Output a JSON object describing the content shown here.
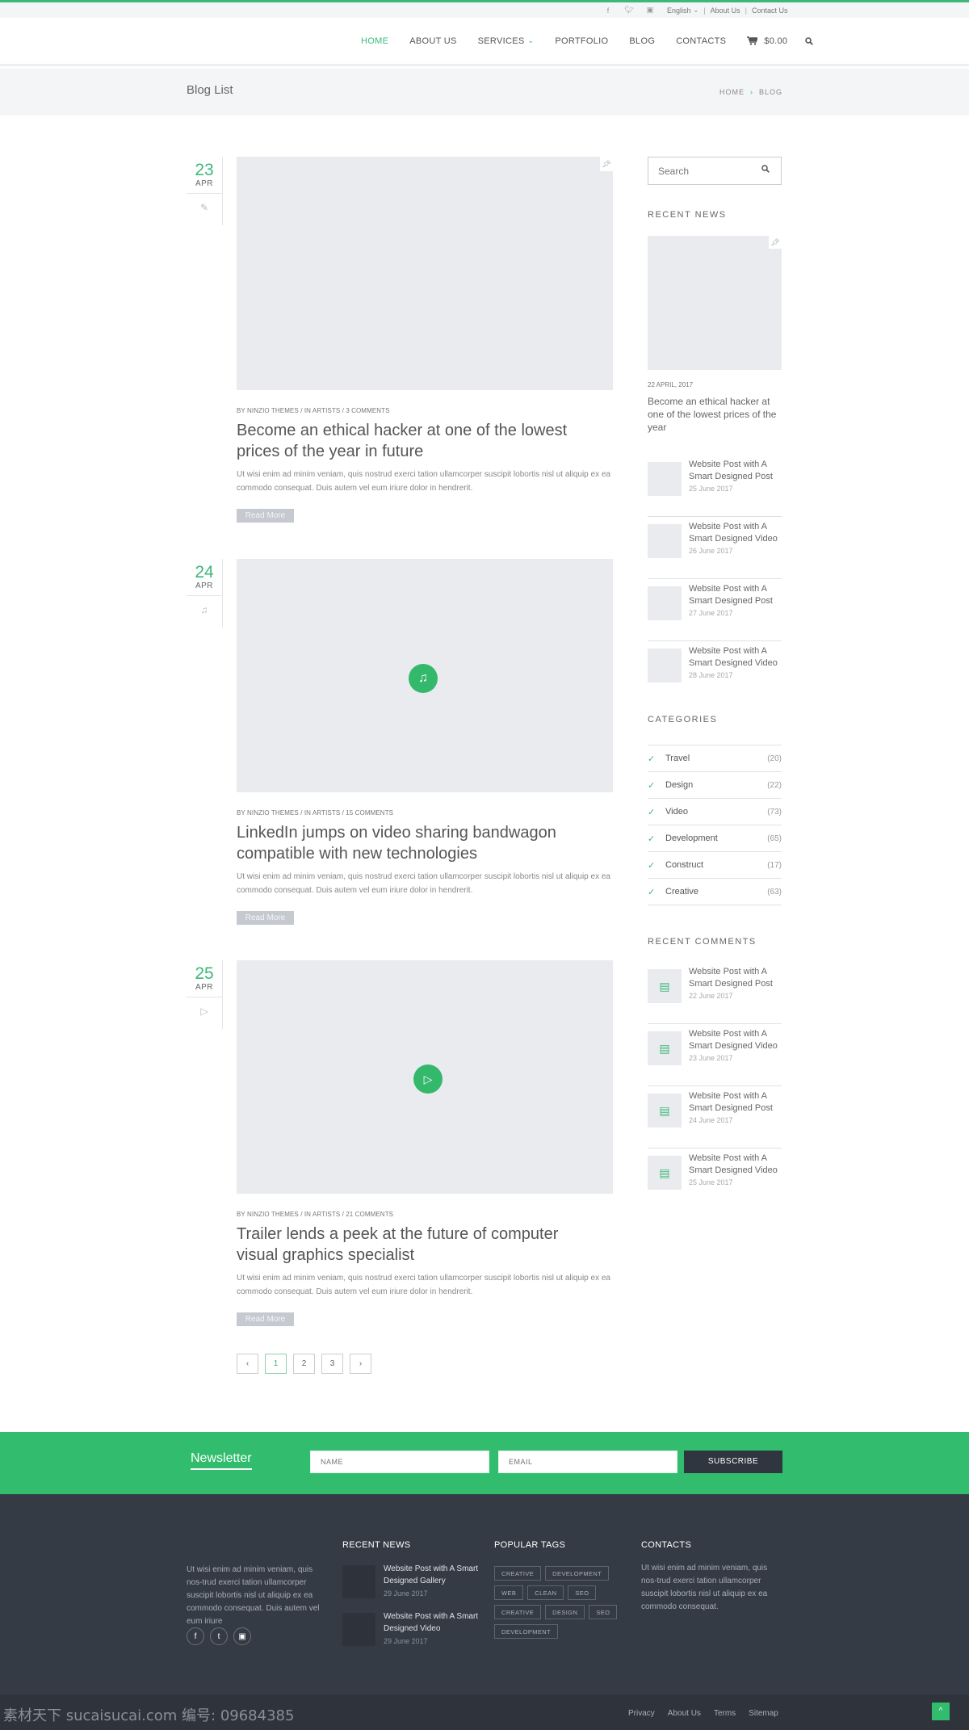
{
  "topbar": {
    "social": [
      "facebook-icon",
      "twitter-icon",
      "instagram-icon"
    ],
    "language": "English",
    "links": [
      "About Us",
      "Contact Us"
    ]
  },
  "nav": {
    "items": [
      {
        "label": "HOME",
        "active": true
      },
      {
        "label": "ABOUT US"
      },
      {
        "label": "SERVICES",
        "dropdown": true
      },
      {
        "label": "PORTFOLIO"
      },
      {
        "label": "BLOG"
      },
      {
        "label": "CONTACTS"
      }
    ],
    "cart_total": "$0.00",
    "icons": {
      "cart": "cart-icon",
      "search": "search-icon"
    }
  },
  "hero": {
    "title": "Blog List",
    "breadcrumb": [
      "HOME",
      "BLOG"
    ]
  },
  "posts": [
    {
      "day": "23",
      "month": "APR",
      "format_icon": "pencil-icon",
      "media_icon": "pin-icon",
      "meta": "BY NINZIO THEMES / IN ARTISTS / 3 COMMENTS",
      "title": "Become an ethical hacker at one of the lowest prices of the year in future",
      "excerpt": "Ut wisi enim ad minim veniam, quis nostrud exerci tation ullamcorper suscipit lobortis nisl ut aliquip ex ea commodo consequat. Duis autem vel eum iriure dolor in hendrerit.",
      "read_more": "Read More"
    },
    {
      "day": "24",
      "month": "APR",
      "format_icon": "music-note-icon",
      "media_icon": "music-note-icon",
      "meta": "BY NINZIO THEMES / IN ARTISTS / 15 COMMENTS",
      "title": "LinkedIn jumps on video sharing bandwagon compatible with new technologies",
      "excerpt": "Ut wisi enim ad minim veniam, quis nostrud exerci tation ullamcorper suscipit lobortis nisl ut aliquip ex ea commodo consequat. Duis autem vel eum iriure dolor in hendrerit.",
      "read_more": "Read More"
    },
    {
      "day": "25",
      "month": "APR",
      "format_icon": "play-icon",
      "media_icon": "play-icon",
      "meta": "BY NINZIO THEMES / IN ARTISTS / 21 COMMENTS",
      "title": "Trailer lends a peek at the future of computer visual graphics specialist",
      "excerpt": "Ut wisi enim ad minim veniam, quis nostrud exerci tation ullamcorper suscipit lobortis nisl ut aliquip ex ea commodo consequat. Duis autem vel eum iriure dolor in hendrerit.",
      "read_more": "Read More"
    }
  ],
  "pagination": {
    "prev": "‹",
    "pages": [
      "1",
      "2",
      "3"
    ],
    "current": "1",
    "next": "›"
  },
  "sidebar": {
    "search_placeholder": "Search",
    "recent_news_title": "RECENT NEWS",
    "featured": {
      "date": "22 APRIL, 2017",
      "title": "Become an ethical hacker at one of the lowest prices of the year"
    },
    "recent_news": [
      {
        "title": "Website Post with A Smart Designed Post",
        "date": "25 June 2017"
      },
      {
        "title": "Website Post with A Smart Designed Video",
        "date": "26 June 2017"
      },
      {
        "title": "Website Post with A Smart Designed Post",
        "date": "27 June 2017"
      },
      {
        "title": "Website Post with A Smart Designed Video",
        "date": "28 June 2017"
      }
    ],
    "categories_title": "CATEGORIES",
    "categories": [
      {
        "name": "Travel",
        "count": "(20)"
      },
      {
        "name": "Design",
        "count": "(22)"
      },
      {
        "name": "Video",
        "count": "(73)"
      },
      {
        "name": "Development",
        "count": "(65)"
      },
      {
        "name": "Construct",
        "count": "(17)"
      },
      {
        "name": "Creative",
        "count": "(63)"
      }
    ],
    "recent_comments_title": "RECENT COMMENTS",
    "recent_comments": [
      {
        "title": "Website Post with A Smart Designed Post",
        "date": "22 June 2017"
      },
      {
        "title": "Website Post with A Smart Designed Video",
        "date": "23 June 2017"
      },
      {
        "title": "Website Post with A Smart Designed Post",
        "date": "24 June 2017"
      },
      {
        "title": "Website Post with A Smart Designed Video",
        "date": "25 June 2017"
      }
    ]
  },
  "newsletter": {
    "title": "Newsletter",
    "name_placeholder": "NAME",
    "email_placeholder": "EMAIL",
    "button": "SUBSCRIBE"
  },
  "footer": {
    "about_text": "Ut wisi enim ad minim veniam, quis nos-trud exerci tation ullamcorper suscipit lobortis nisl ut aliquip ex ea commodo consequat. Duis autem vel eum iriure",
    "recent_news_title": "RECENT NEWS",
    "recent_news": [
      {
        "title": "Website Post with A Smart Designed Gallery",
        "date": "29 June 2017"
      },
      {
        "title": "Website Post with A Smart Designed Video",
        "date": "29 June 2017"
      }
    ],
    "tags_title": "POPULAR TAGS",
    "tags": [
      "CREATIVE",
      "DEVELOPMENT",
      "WEB",
      "CLEAN",
      "SEO",
      "CREATIVE",
      "DESIGN",
      "SEO",
      "DEVELOPMENT"
    ],
    "contacts_title": "CONTACTS",
    "contacts_text": "Ut wisi enim ad minim veniam, quis nos-trud exerci tation ullamcorper suscipit lobortis nisl ut aliquip ex ea commodo consequat."
  },
  "bottom": {
    "watermark": "素材天下 sucaisucai.com  编号: 09684385",
    "links": [
      "Privacy",
      "About Us",
      "Terms",
      "Sitemap"
    ],
    "to_top": "^"
  },
  "colors": {
    "accent": "#3cb87a",
    "footer_bg": "#353b45",
    "newsletter_bg": "#32bd6e"
  }
}
